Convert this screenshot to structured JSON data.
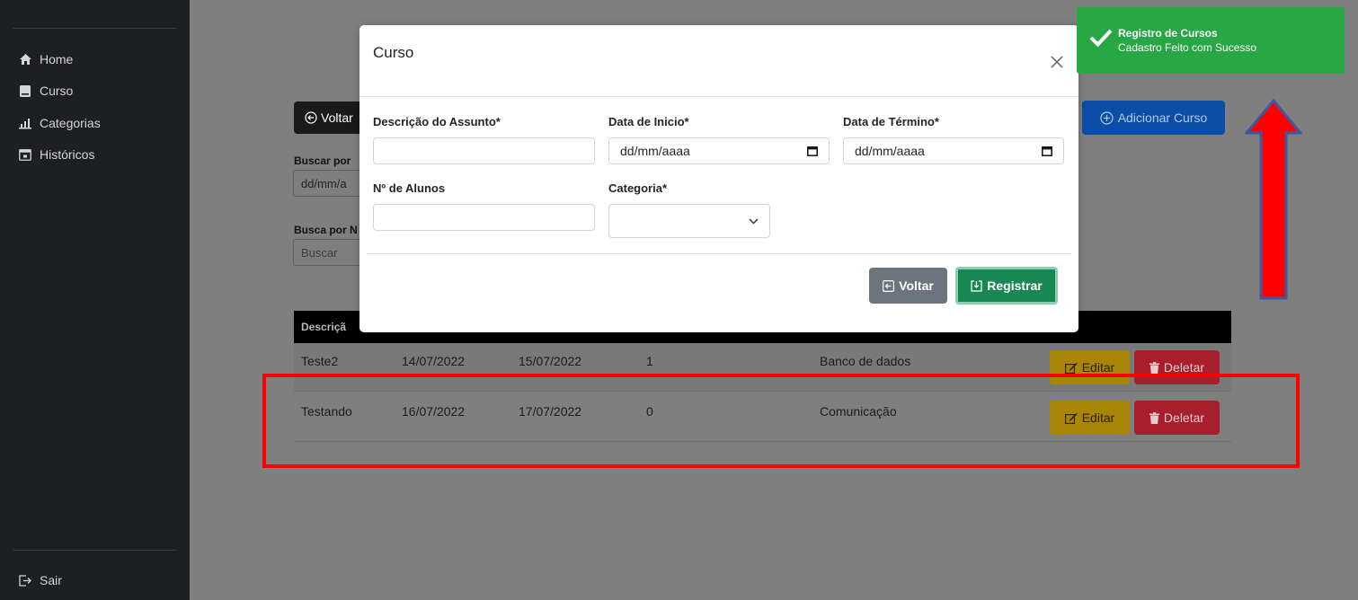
{
  "sidebar": {
    "items": [
      {
        "label": "Home",
        "icon": "home-icon"
      },
      {
        "label": "Curso",
        "icon": "book-icon"
      },
      {
        "label": "Categorias",
        "icon": "bar-chart-icon"
      },
      {
        "label": "Históricos",
        "icon": "calendar-icon"
      }
    ],
    "logout": {
      "label": "Sair",
      "icon": "sign-out-icon"
    }
  },
  "page": {
    "back_label": "Voltar",
    "add_label": "Adicionar Curso",
    "search_date_label": "Buscar por",
    "search_date_value": "dd/mm/a",
    "search_name_label": "Busca por N",
    "search_name_placeholder": "Buscar",
    "table": {
      "header_first": "Descriçã",
      "rows": [
        {
          "descricao": "Teste2",
          "inicio": "14/07/2022",
          "termino": "15/07/2022",
          "alunos": "1",
          "categoria": "Banco de dados"
        },
        {
          "descricao": "Testando",
          "inicio": "16/07/2022",
          "termino": "17/07/2022",
          "alunos": "0",
          "categoria": "Comunicação"
        }
      ],
      "edit_label": "Editar",
      "delete_label": "Deletar"
    }
  },
  "modal": {
    "title": "Curso",
    "fields": {
      "descricao_label": "Descrição do Assunto*",
      "descricao_value": "",
      "inicio_label": "Data de Inicio*",
      "inicio_value": "dd/mm/aaaa",
      "termino_label": "Data de Término*",
      "termino_value": "dd/mm/aaaa",
      "alunos_label": "Nº de Alunos",
      "alunos_value": "",
      "categoria_label": "Categoria*",
      "categoria_value": ""
    },
    "back_label": "Voltar",
    "register_label": "Registrar"
  },
  "toast": {
    "title": "Registro de Cursos",
    "message": "Cadastro Feito com Sucesso"
  },
  "colors": {
    "sidebar_bg": "#1e1f21",
    "backdrop": "#7f7f7f",
    "success": "#198754",
    "toast_bg": "#28a745",
    "annotation_red": "#ff0000"
  }
}
